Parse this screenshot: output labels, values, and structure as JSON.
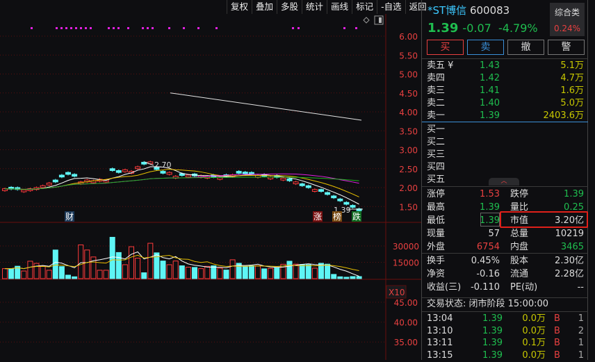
{
  "toolbar": [
    "复权",
    "叠加",
    "多股",
    "统计",
    "画线",
    "标记",
    "-自选",
    "返回"
  ],
  "stock": {
    "name": "*ST博信",
    "code": "600083",
    "price": "1.39",
    "change": "-0.07",
    "pct": "-4.79%",
    "sector": "综合类",
    "sector_pct": "0.24%"
  },
  "buttons": [
    "买",
    "卖",
    "撤",
    "警"
  ],
  "asks": [
    {
      "l": "卖五 ¥",
      "p": "1.43",
      "v": "5.1万"
    },
    {
      "l": "卖四",
      "p": "1.42",
      "v": "4.7万"
    },
    {
      "l": "卖三",
      "p": "1.41",
      "v": "1.6万"
    },
    {
      "l": "卖二",
      "p": "1.40",
      "v": "5.0万"
    },
    {
      "l": "卖一",
      "p": "1.39",
      "v": "2403.6万"
    }
  ],
  "bids": [
    {
      "l": "买一"
    },
    {
      "l": "买二"
    },
    {
      "l": "买三"
    },
    {
      "l": "买四"
    },
    {
      "l": "买五"
    }
  ],
  "stats": [
    {
      "l1": "涨停",
      "v1": "1.53",
      "c1": "r",
      "l2": "跌停",
      "v2": "1.39",
      "c2": "g"
    },
    {
      "l1": "最高",
      "v1": "1.39",
      "c1": "g",
      "l2": "量比",
      "v2": "0.25",
      "c2": "g"
    },
    {
      "l1": "最低",
      "v1": "1.39",
      "c1": "g",
      "l2": "市值",
      "v2": "3.20亿",
      "c2": "w"
    },
    {
      "l1": "现量",
      "v1": "57",
      "c1": "w",
      "l2": "总量",
      "v2": "10219",
      "c2": "w"
    },
    {
      "l1": "外盘",
      "v1": "6754",
      "c1": "r",
      "l2": "内盘",
      "v2": "3465",
      "c2": "g"
    }
  ],
  "fin": [
    {
      "l1": "换手",
      "v1": "0.45%",
      "l2": "股本",
      "v2": "2.30亿"
    },
    {
      "l1": "净资",
      "v1": "-0.16",
      "l2": "流通",
      "v2": "2.28亿"
    },
    {
      "l1": "收益(三)",
      "v1": "-0.110",
      "l2": "PE(动)",
      "v2": "--"
    }
  ],
  "status": "交易状态: 闭市阶段 15:00:00",
  "ticks": [
    {
      "t": "13:04",
      "p": "1.39",
      "v": "0.0万",
      "s": "B",
      "n": "1"
    },
    {
      "t": "13:10",
      "p": "1.39",
      "v": "0.0万",
      "s": "B",
      "n": "2"
    },
    {
      "t": "13:11",
      "p": "1.39",
      "v": "0.1万",
      "s": "B",
      "n": "1"
    },
    {
      "t": "13:15",
      "p": "1.39",
      "v": "0.0万",
      "s": "B",
      "n": "1"
    }
  ],
  "chart_data": {
    "type": "candlestick",
    "price_ticks": [
      "6.00",
      "5.50",
      "5.00",
      "4.50",
      "4.00",
      "3.50",
      "3.00",
      "2.50",
      "2.00",
      "1.50"
    ],
    "vol_ticks": [
      "30000",
      "15000"
    ],
    "vol_unit": "X10",
    "ind_ticks": [
      "45.00",
      "40.00",
      "35.00"
    ],
    "high_label": "2.70",
    "low_label": "1.39",
    "markers": [
      "财",
      "涨",
      "榜",
      "跌"
    ],
    "ma_long": [
      4.5,
      3.78
    ],
    "closes": [
      1.97,
      1.96,
      1.95,
      1.94,
      1.97,
      2.0,
      2.05,
      2.12,
      2.15,
      2.28,
      2.35,
      2.3,
      2.15,
      2.2,
      2.18,
      2.22,
      2.2,
      2.45,
      2.4,
      2.47,
      2.43,
      2.55,
      2.62,
      2.68,
      2.48,
      2.38,
      2.4,
      2.3,
      2.32,
      2.33,
      2.31,
      2.32,
      2.3,
      2.28,
      2.27,
      2.29,
      2.34,
      2.38,
      2.36,
      2.35,
      2.32,
      2.3,
      2.28,
      2.27,
      2.25,
      2.18,
      2.15,
      2.05,
      2.0,
      1.95,
      1.9,
      1.82,
      1.73,
      1.65,
      1.56,
      1.48,
      1.39
    ],
    "up": [
      1,
      0,
      0,
      1,
      1,
      1,
      1,
      1,
      0,
      0,
      0,
      0,
      1,
      1,
      1,
      1,
      1,
      0,
      0,
      1,
      1,
      1,
      0,
      1,
      0,
      0,
      1,
      1,
      0,
      1,
      0,
      1,
      1,
      0,
      1,
      0,
      1,
      0,
      0,
      0,
      1,
      0,
      1,
      0,
      1,
      0,
      1,
      0,
      0,
      1,
      0,
      0,
      0,
      0,
      0,
      0,
      0
    ],
    "volumes": [
      9200,
      9200,
      11400,
      7000,
      16000,
      14000,
      11800,
      7700,
      26300,
      11100,
      3200,
      1700,
      31000,
      26300,
      19900,
      7700,
      7700,
      38000,
      24000,
      12800,
      29300,
      18800,
      5400,
      32500,
      23700,
      16200,
      12800,
      16200,
      11800,
      10500,
      10300,
      9200,
      11300,
      11800,
      9600,
      7900,
      17300,
      14100,
      11300,
      11800,
      11800,
      9000,
      9400,
      9800,
      13200,
      16000,
      13300,
      13000,
      12800,
      9600,
      14100,
      13300,
      3900,
      1700,
      1300,
      1900,
      1900
    ]
  }
}
